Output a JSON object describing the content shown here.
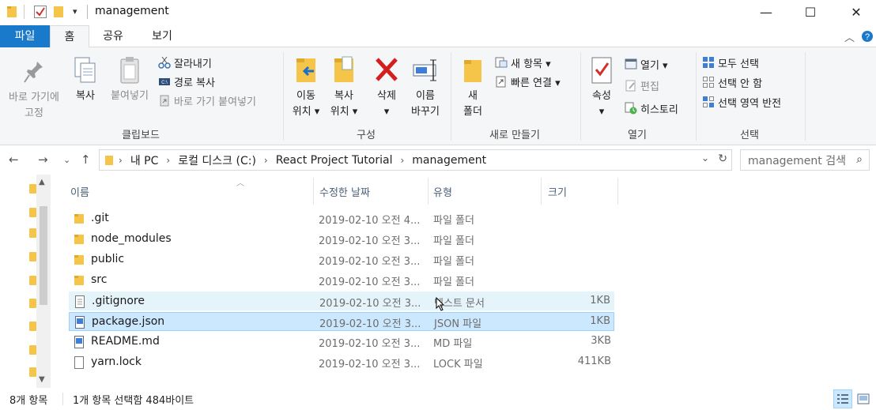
{
  "window": {
    "title": "management",
    "minimize_glyph": "—",
    "maximize_glyph": "☐",
    "close_glyph": "✕"
  },
  "ribbon_tabs": {
    "file": "파일",
    "home": "홈",
    "share": "공유",
    "view": "보기"
  },
  "ribbon": {
    "clipboard": {
      "group_label": "클립보드",
      "pin_line1": "바로 가기에",
      "pin_line2": "고정",
      "copy": "복사",
      "paste": "붙여넣기",
      "cut": "잘라내기",
      "copy_path": "경로 복사",
      "paste_shortcut": "바로 가기 붙여넣기"
    },
    "organize": {
      "group_label": "구성",
      "move_line1": "이동",
      "move_line2": "위치 ▾",
      "copy_line1": "복사",
      "copy_line2": "위치 ▾",
      "delete_line1": "삭제",
      "delete_line2": "▾",
      "rename_line1": "이름",
      "rename_line2": "바꾸기"
    },
    "new": {
      "group_label": "새로 만들기",
      "folder_line1": "새",
      "folder_line2": "폴더",
      "new_item": "새 항목 ▾",
      "easy_access": "빠른 연결 ▾"
    },
    "open": {
      "group_label": "열기",
      "properties_line1": "속성",
      "properties_line2": "▾",
      "open": "열기 ▾",
      "edit": "편집",
      "history": "히스토리"
    },
    "select": {
      "group_label": "선택",
      "select_all": "모두 선택",
      "select_none": "선택 안 함",
      "invert": "선택 영역 반전"
    }
  },
  "address": {
    "crumbs": [
      "내 PC",
      "로컬 디스크 (C:)",
      "React Project Tutorial",
      "management"
    ]
  },
  "search": {
    "placeholder": "management 검색"
  },
  "columns": {
    "name": "이름",
    "modified": "수정한 날짜",
    "type": "유형",
    "size": "크기"
  },
  "files": [
    {
      "name": ".git",
      "date": "2019-02-10 오전 4...",
      "type": "파일 폴더",
      "size": "",
      "icon": "folder-icon"
    },
    {
      "name": "node_modules",
      "date": "2019-02-10 오전 3...",
      "type": "파일 폴더",
      "size": "",
      "icon": "folder-icon"
    },
    {
      "name": "public",
      "date": "2019-02-10 오전 3...",
      "type": "파일 폴더",
      "size": "",
      "icon": "folder-icon"
    },
    {
      "name": "src",
      "date": "2019-02-10 오전 3...",
      "type": "파일 폴더",
      "size": "",
      "icon": "folder-icon"
    },
    {
      "name": ".gitignore",
      "date": "2019-02-10 오전 3...",
      "type": "텍스트 문서",
      "size": "1KB",
      "icon": "text-file-icon"
    },
    {
      "name": "package.json",
      "date": "2019-02-10 오전 3...",
      "type": "JSON 파일",
      "size": "1KB",
      "icon": "json-file-icon"
    },
    {
      "name": "README.md",
      "date": "2019-02-10 오전 3...",
      "type": "MD 파일",
      "size": "3KB",
      "icon": "md-file-icon"
    },
    {
      "name": "yarn.lock",
      "date": "2019-02-10 오전 3...",
      "type": "LOCK 파일",
      "size": "411KB",
      "icon": "blank-file-icon"
    }
  ],
  "status": {
    "item_count": "8개 항목",
    "selection": "1개 항목 선택함 484바이트"
  },
  "colors": {
    "file_tab": "#1979ca",
    "selection": "#cce8ff",
    "selection_border": "#99d1ff",
    "hover": "#e5f3fb",
    "folder": "#f5c549"
  }
}
